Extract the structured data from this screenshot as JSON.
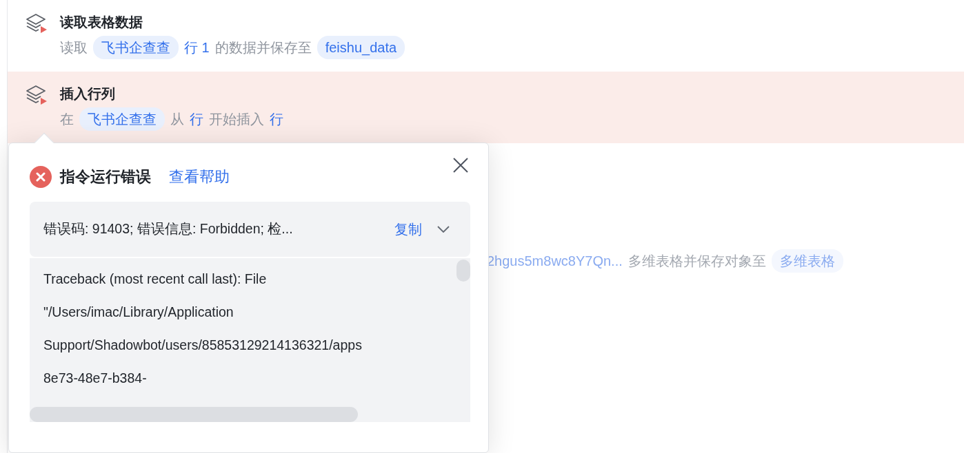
{
  "steps": [
    {
      "title": "读取表格数据",
      "highlighted": false,
      "parts": [
        {
          "kind": "text",
          "text": "读取"
        },
        {
          "kind": "chip",
          "text": "飞书企查查"
        },
        {
          "kind": "value",
          "text": "行 1"
        },
        {
          "kind": "text",
          "text": "的数据并保存至"
        },
        {
          "kind": "chip",
          "text": "feishu_data"
        }
      ]
    },
    {
      "title": "插入行列",
      "highlighted": true,
      "parts": [
        {
          "kind": "text",
          "text": "在"
        },
        {
          "kind": "chip",
          "text": "飞书企查查"
        },
        {
          "kind": "text",
          "text": "从"
        },
        {
          "kind": "value",
          "text": "行"
        },
        {
          "kind": "text",
          "text": "开始插入"
        },
        {
          "kind": "value",
          "text": "行"
        }
      ]
    }
  ],
  "background_step": {
    "parts": [
      {
        "kind": "value",
        "text": "2hgus5m8wc8Y7Qn..."
      },
      {
        "kind": "text",
        "text": "多维表格并保存对象至"
      },
      {
        "kind": "chip",
        "text": "多维表格"
      }
    ]
  },
  "error_popup": {
    "title": "指令运行错误",
    "help_link": "查看帮助",
    "summary": "错误码: 91403; 错误信息: Forbidden; 检...",
    "copy": "复制",
    "traceback_lines": [
      "Traceback (most recent call last): File",
      "\"/Users/imac/Library/Application",
      "Support/Shadowbot/users/85853129214136321/apps",
      "8e73-48e7-b384-"
    ]
  }
}
